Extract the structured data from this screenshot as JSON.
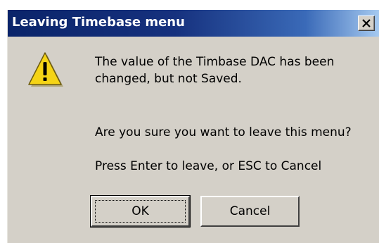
{
  "dialog": {
    "title": "Leaving Timebase menu",
    "close_icon": "close-icon",
    "warning_icon": "warning-icon",
    "message_line_1": "The value of the Timbase DAC has been",
    "message_line_2": "changed, but not Saved.",
    "question": "Are you sure you want to leave this menu?",
    "instruction": "Press Enter to leave, or ESC to Cancel",
    "ok_label": "OK",
    "cancel_label": "Cancel"
  },
  "colors": {
    "titlebar_start": "#0a246a",
    "titlebar_end": "#a6caf0",
    "dialog_bg": "#d4d0c8",
    "warning_yellow": "#f5d416"
  }
}
